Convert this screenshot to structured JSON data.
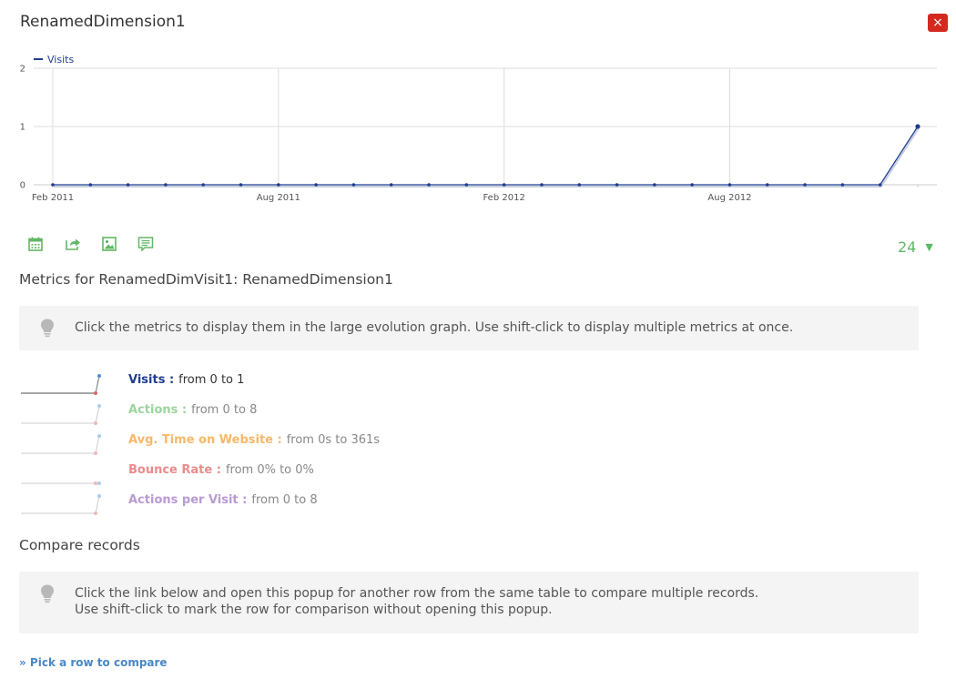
{
  "window": {
    "title": "RenamedDimension1",
    "close_label": "×"
  },
  "chart_data": {
    "type": "line",
    "legend": {
      "placement": "top-left",
      "entries": [
        "Visits"
      ]
    },
    "series": [
      {
        "name": "Visits",
        "color": "#1f3d8f",
        "values": [
          0,
          0,
          0,
          0,
          0,
          0,
          0,
          0,
          0,
          0,
          0,
          0,
          0,
          0,
          0,
          0,
          0,
          0,
          0,
          0,
          0,
          0,
          0,
          1
        ]
      }
    ],
    "x_tick_labels": [
      "Feb 2011",
      "Aug 2011",
      "Feb 2012",
      "Aug 2012"
    ],
    "x_tick_label_indices": [
      0,
      6,
      12,
      18
    ],
    "ylim": [
      0,
      2
    ],
    "y_ticks": [
      0,
      1,
      2
    ],
    "grid": true
  },
  "toolbar": {
    "icons": [
      "calendar-icon",
      "share-icon",
      "image-icon",
      "annotation-icon"
    ],
    "limit_value": "24",
    "limit_caret": "▼"
  },
  "metrics_section": {
    "title": "Metrics for RenamedDimVisit1: RenamedDimension1",
    "tip": "Click the metrics to display them in the large evolution graph. Use shift-click to display multiple metrics at once.",
    "metrics": [
      {
        "name": "Visits :",
        "range": "from 0 to 1",
        "color": "#1f3d8f",
        "range_color": "#333333",
        "spark": [
          0,
          1
        ]
      },
      {
        "name": "Actions :",
        "range": "from 0 to 8",
        "color": "#9cd49e",
        "range_color": "#888888",
        "spark": [
          0,
          1
        ]
      },
      {
        "name": "Avg. Time on Website :",
        "range": "from 0s to 361s",
        "color": "#f7b86a",
        "range_color": "#888888",
        "spark": [
          0,
          1
        ]
      },
      {
        "name": "Bounce Rate :",
        "range": "from 0% to 0%",
        "color": "#ec8a8a",
        "range_color": "#888888",
        "spark": [
          0,
          0
        ]
      },
      {
        "name": "Actions per Visit :",
        "range": "from 0 to 8",
        "color": "#b99ad2",
        "range_color": "#888888",
        "spark": [
          0,
          1
        ]
      }
    ]
  },
  "compare_section": {
    "title": "Compare records",
    "tip_line1": "Click the link below and open this popup for another row from the same table to compare multiple records.",
    "tip_line2": "Use shift-click to mark the row for comparison without opening this popup.",
    "link": "» Pick a row to compare"
  }
}
